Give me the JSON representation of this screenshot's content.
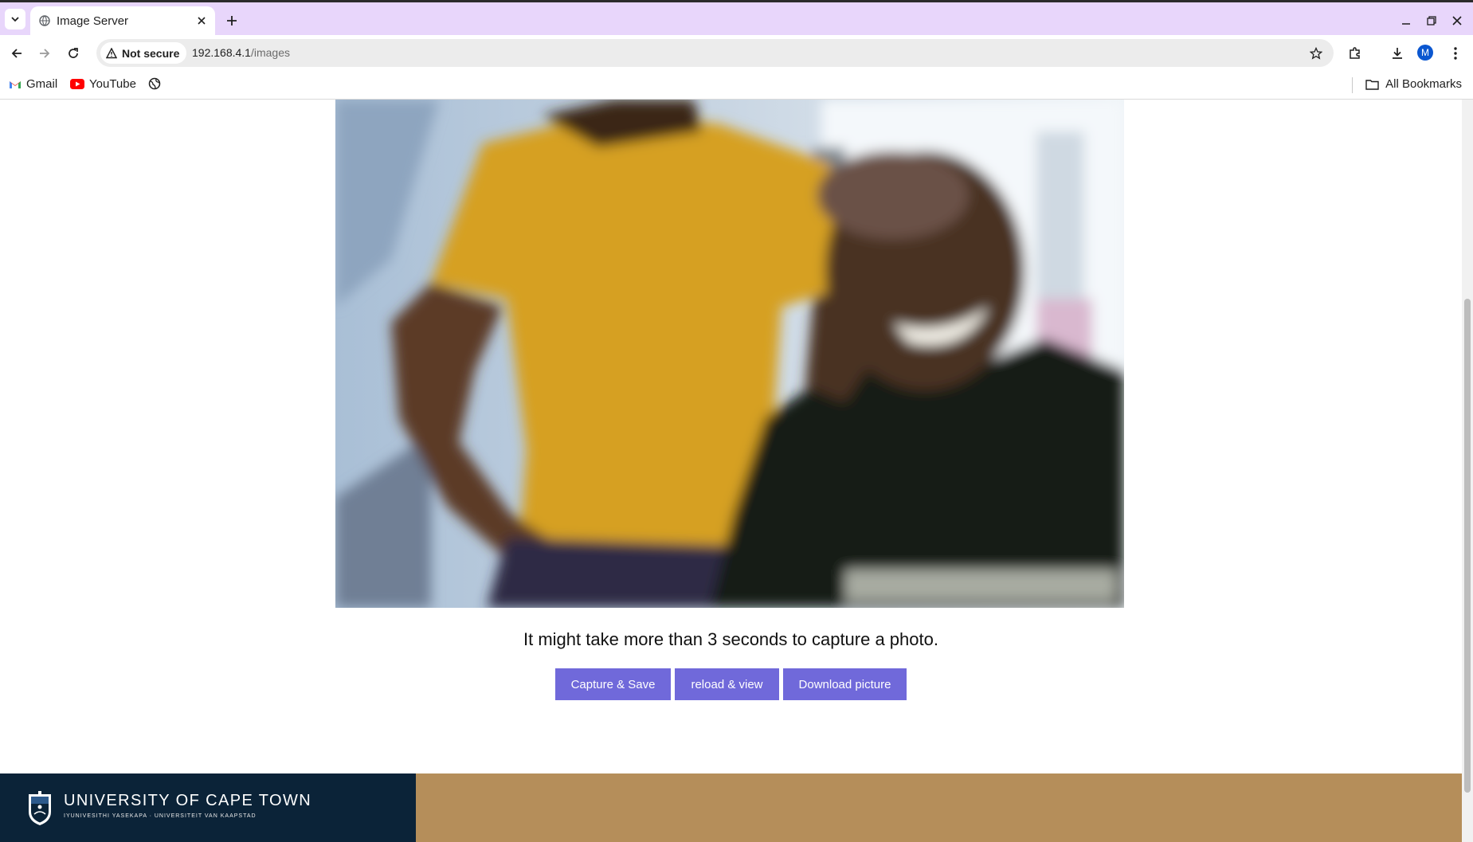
{
  "browser": {
    "tab_title": "Image Server",
    "security_label": "Not secure",
    "url_host": "192.168.4.1",
    "url_path": "/images",
    "profile_initial": "M",
    "bookmarks": [
      {
        "label": "Gmail",
        "icon": "gmail-icon"
      },
      {
        "label": "YouTube",
        "icon": "youtube-icon"
      }
    ],
    "all_bookmarks_label": "All Bookmarks"
  },
  "page": {
    "caption": "It might take more than 3 seconds to capture a photo.",
    "buttons": {
      "capture": "Capture & Save",
      "reload": "reload & view",
      "download": "Download picture"
    },
    "button_color": "#7069da",
    "footer": {
      "name": "UNIVERSITY OF CAPE TOWN",
      "subtitle": "IYUNIVESITHI YASEKAPA · UNIVERSITEIT VAN KAAPSTAD",
      "left_color": "#0b2338",
      "right_color": "#b58e5a"
    }
  }
}
